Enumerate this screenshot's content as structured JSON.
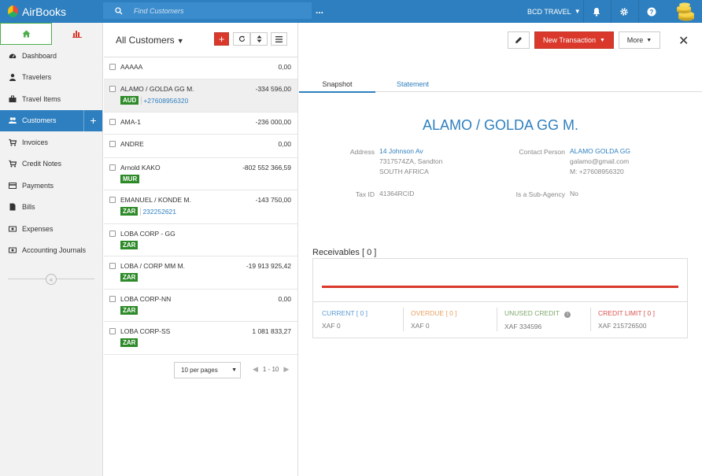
{
  "app": {
    "name": "AirBooks"
  },
  "topbar": {
    "search_placeholder": "Find Customers",
    "more_dots": "...",
    "company": "BCD TRAVEL"
  },
  "sidebar": {
    "items": [
      {
        "label": "Dashboard"
      },
      {
        "label": "Travelers"
      },
      {
        "label": "Travel Items"
      },
      {
        "label": "Customers"
      },
      {
        "label": "Invoices"
      },
      {
        "label": "Credit Notes"
      },
      {
        "label": "Payments"
      },
      {
        "label": "Bills"
      },
      {
        "label": "Expenses"
      },
      {
        "label": "Accounting Journals"
      }
    ],
    "add_label": "+",
    "collapse_label": "«"
  },
  "list": {
    "title": "All Customers",
    "add_label": "+",
    "rows": [
      {
        "name": "AAAAA",
        "amount": "0,00"
      },
      {
        "name": "ALAMO / GOLDA GG M.",
        "amount": "-334 596,00",
        "currency": "AUD",
        "phone": "+27608956320"
      },
      {
        "name": "AMA-1",
        "amount": "-236 000,00"
      },
      {
        "name": "ANDRE",
        "amount": "0,00"
      },
      {
        "name": "Arnold KAKO",
        "amount": "-802 552 366,59",
        "currency": "MUR"
      },
      {
        "name": "EMANUEL / KONDE M.",
        "amount": "-143 750,00",
        "currency": "ZAR",
        "phone": "232252621"
      },
      {
        "name": "LOBA CORP - GG",
        "amount": "",
        "currency": "ZAR"
      },
      {
        "name": "LOBA / CORP MM M.",
        "amount": "-19 913 925,42",
        "currency": "ZAR"
      },
      {
        "name": "LOBA CORP-NN",
        "amount": "0,00",
        "currency": "ZAR"
      },
      {
        "name": "LOBA CORP-SS",
        "amount": "1 081 833,27",
        "currency": "ZAR"
      }
    ],
    "per_page": "10 per pages",
    "page_range": "1 - 10"
  },
  "detail": {
    "new_transaction": "New Transaction",
    "more": "More",
    "tabs": {
      "snapshot": "Snapshot",
      "statement": "Statement"
    },
    "customer_name": "ALAMO / GOLDA GG M.",
    "address_label": "Address",
    "address": {
      "line1": "14 Johnson Av",
      "line2": "7317574ZA, Sandton",
      "line3": "SOUTH AFRICA"
    },
    "tax_label": "Tax ID",
    "tax_id": "41364RCID",
    "contact_label": "Contact Person",
    "contact": {
      "name": "ALAMO GOLDA GG",
      "email": "galamo@gmail.com",
      "mobile": "M: +27608956320"
    },
    "subagency_label": "Is a Sub-Agency",
    "subagency": "No",
    "receivables_title": "Receivables [ 0 ]",
    "stats": {
      "current_label": "CURRENT [ 0 ]",
      "current_value": "XAF 0",
      "overdue_label": "OVERDUE [ 0 ]",
      "overdue_value": "XAF 0",
      "unused_label": "UNUSED CREDIT",
      "unused_value": "XAF 334596",
      "limit_label": "CREDIT LIMIT [ 0 ]",
      "limit_value": "XAF 215726500"
    }
  },
  "colors": {
    "primary": "#2e7fbf",
    "danger": "#d9382b",
    "success": "#2d8a28",
    "current": "#5b9bd5",
    "overdue": "#e8a060",
    "unused": "#7fa86a",
    "limit": "#d9534f"
  }
}
